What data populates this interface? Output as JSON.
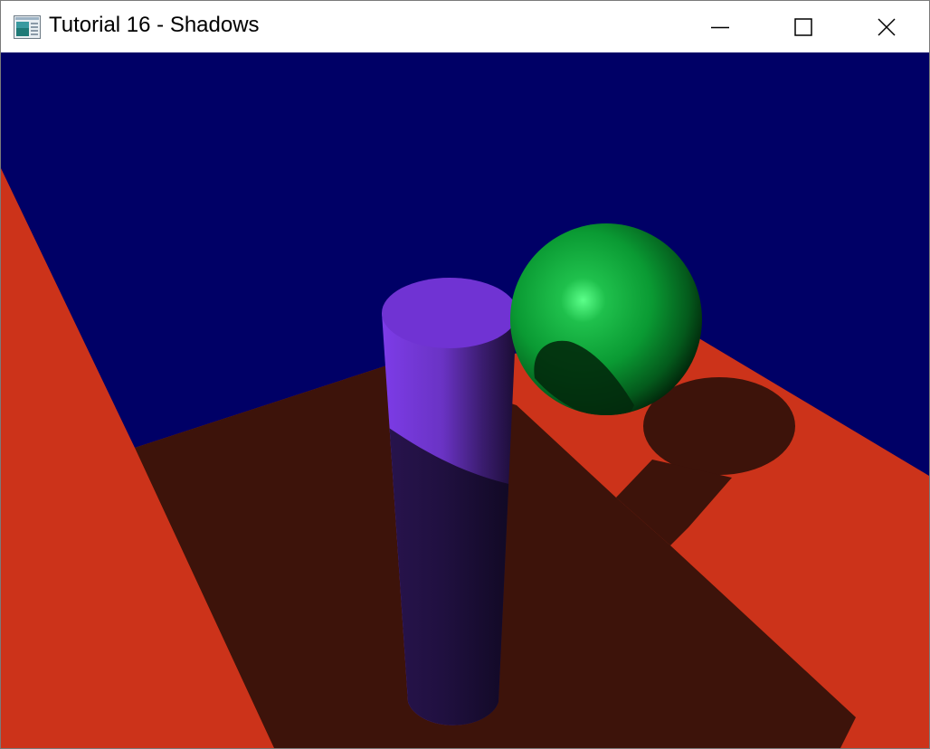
{
  "window": {
    "title": "Tutorial 16 - Shadows",
    "app_icon": "app-window-icon",
    "controls": {
      "minimize_icon": "minimize-icon",
      "maximize_icon": "maximize-icon",
      "close_icon": "close-icon"
    }
  },
  "scene": {
    "background_color": "#000066",
    "floor_color": "#cc331a",
    "shadow_color": "#3d130a",
    "cylinder_color": "#7033d3",
    "sphere_color": "#0a9a33"
  }
}
